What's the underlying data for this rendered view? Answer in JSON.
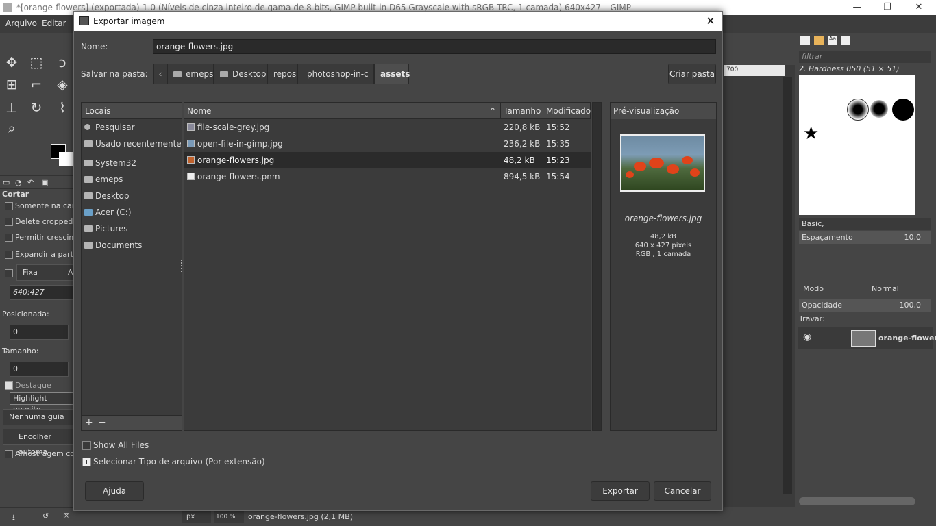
{
  "gimp_window": {
    "title": "*[orange-flowers] (exportada)-1.0 (Níveis de cinza inteiro de gama de 8 bits, GIMP built-in D65 Grayscale with sRGB TRC, 1 camada) 640x427 – GIMP",
    "menu": [
      "Arquivo",
      "Editar"
    ],
    "controls": {
      "minimize": "—",
      "restore": "❐",
      "close": "✕"
    }
  },
  "tool_options": {
    "title": "Cortar",
    "options": [
      "Somente na cama",
      "Delete cropped p",
      "Permitir crescime",
      "Expandir a partir"
    ],
    "fixed_label": "Fixa",
    "fixed_right": "A",
    "ratio_value": "640:427",
    "position_label": "Posicionada:",
    "position_value": "0",
    "size_label": "Tamanho:",
    "size_value": "0",
    "highlight_label": "Destaque",
    "highlight_opacity": "Highlight opacity",
    "guides_value": "Nenhuma guia",
    "auto_shrink": "Encolher automa",
    "sample_merged": "Amostragem com"
  },
  "dock": {
    "filter_placeholder": "filtrar",
    "brush_name": "2. Hardness 050 (51 × 51)",
    "brush_set": "Basic,",
    "spacing_label": "Espaçamento",
    "spacing_value": "10,0",
    "mode_label": "Modo",
    "mode_value": "Normal",
    "opacity_label": "Opacidade",
    "opacity_value": "100,0",
    "lock_label": "Travar:",
    "layer_name": "orange-flower"
  },
  "statusbar": {
    "unit": "px",
    "zoom": "100 %",
    "file_info": "orange-flowers.jpg (2,1 MB)"
  },
  "ruler_label": "700",
  "dialog": {
    "title": "Exportar imagem",
    "name_label": "Nome:",
    "name_value": "orange-flowers.jpg",
    "folder_label": "Salvar na pasta:",
    "breadcrumbs": [
      "emeps",
      "Desktop",
      "repos",
      "photoshop-in-c",
      "assets"
    ],
    "create_folder": "Criar pasta",
    "places_header": "Locais",
    "places": [
      "Pesquisar",
      "Usado recentemente",
      "System32",
      "emeps",
      "Desktop",
      "Acer (C:)",
      "Pictures",
      "Documents"
    ],
    "columns": {
      "name": "Nome",
      "size": "Tamanho",
      "modified": "Modificado"
    },
    "files": [
      {
        "name": "file-scale-grey.jpg",
        "size": "220,8 kB",
        "modified": "15:52"
      },
      {
        "name": "open-file-in-gimp.jpg",
        "size": "236,2 kB",
        "modified": "15:35"
      },
      {
        "name": "orange-flowers.jpg",
        "size": "48,2 kB",
        "modified": "15:23"
      },
      {
        "name": "orange-flowers.pnm",
        "size": "894,5 kB",
        "modified": "15:54"
      }
    ],
    "selected_file": "orange-flowers.jpg",
    "preview": {
      "header": "Pré-visualização",
      "filename": "orange-flowers.jpg",
      "size": "48,2 kB",
      "dimensions": "640 x 427 pixels",
      "mode": "RGB , 1 camada"
    },
    "show_all_files": "Show All Files",
    "select_type": "Selecionar Tipo de arquivo (Por extensão)",
    "help_button": "Ajuda",
    "export_button": "Exportar",
    "cancel_button": "Cancelar"
  }
}
